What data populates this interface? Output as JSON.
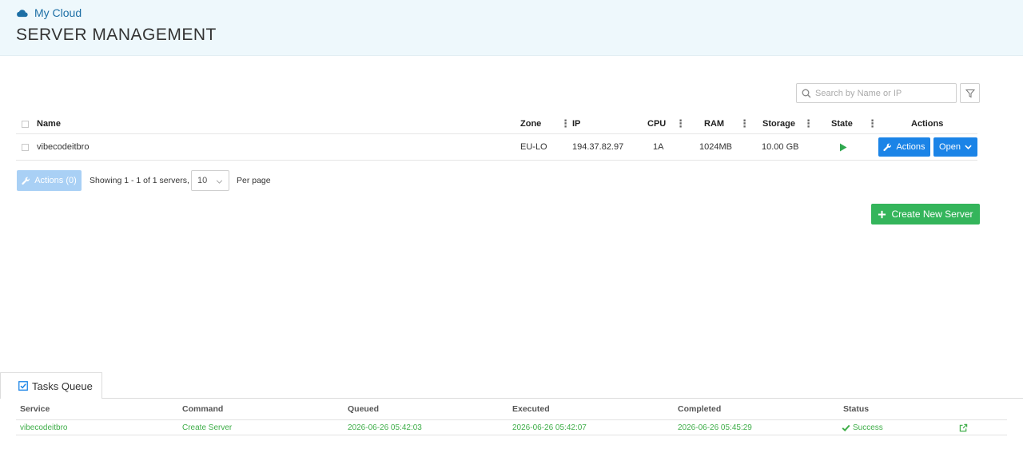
{
  "header": {
    "brand": "My Cloud",
    "title": "SERVER MANAGEMENT"
  },
  "search": {
    "placeholder": "Search by Name or IP"
  },
  "server_table": {
    "columns": {
      "name": "Name",
      "zone": "Zone",
      "ip": "IP",
      "cpu": "CPU",
      "ram": "RAM",
      "storage": "Storage",
      "state": "State",
      "actions": "Actions"
    },
    "rows": [
      {
        "name": "vibecodeitbro",
        "zone": "EU-LO",
        "ip": "194.37.82.97",
        "cpu": "1A",
        "ram": "1024MB",
        "storage": "10.00 GB",
        "state_icon": "play-icon",
        "actions_label": "Actions",
        "open_label": "Open"
      }
    ]
  },
  "pagination": {
    "bulk_actions_label": "Actions (0)",
    "showing_text": "Showing 1 - 1 of 1 servers,",
    "per_page_value": "10",
    "per_page_label": "Per page"
  },
  "create_button_label": "Create New Server",
  "tasks": {
    "tab_label": "Tasks Queue",
    "columns": {
      "service": "Service",
      "command": "Command",
      "queued": "Queued",
      "executed": "Executed",
      "completed": "Completed",
      "status": "Status"
    },
    "rows": [
      {
        "service": "vibecodeitbro",
        "command": "Create Server",
        "queued": "2026-06-26 05:42:03",
        "executed": "2026-06-26 05:42:07",
        "completed": "2026-06-26 05:45:29",
        "status": "Success"
      }
    ]
  },
  "colors": {
    "primary": "#1b84e7",
    "primary_disabled": "#a9d0f5",
    "success": "#34b55b",
    "task_text": "#3fae49",
    "header_bg": "#eef8fc",
    "brand": "#1d6fa5"
  }
}
